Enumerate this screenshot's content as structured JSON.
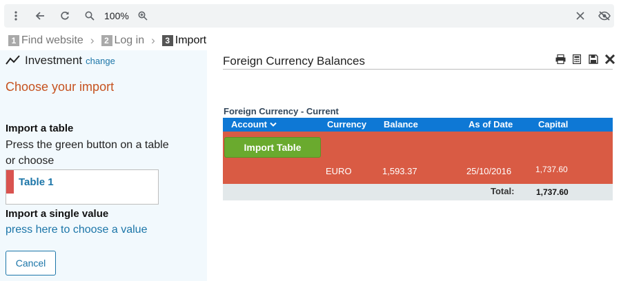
{
  "toolbar": {
    "zoom": "100%",
    "icons": [
      "more-vert-icon",
      "back-arrow-icon",
      "refresh-icon",
      "zoom-out-icon",
      "zoom-in-icon",
      "close-icon",
      "hide-icon"
    ]
  },
  "breadcrumb": [
    {
      "num": "1",
      "label": "Find website"
    },
    {
      "num": "2",
      "label": "Log in"
    },
    {
      "num": "3",
      "label": "Import"
    }
  ],
  "sidebar": {
    "investment_label": "Investment",
    "change_link": "change",
    "choose_title": "Choose your import",
    "import_table_heading": "Import a table",
    "import_table_desc_1": "Press the green button on a table",
    "import_table_desc_2": "or choose",
    "tables": [
      {
        "label": "Table 1"
      }
    ],
    "single_value_heading": "Import a single value",
    "single_value_link": "press here to choose a value",
    "cancel_label": "Cancel"
  },
  "main": {
    "title": "Foreign Currency Balances",
    "table_caption": "Foreign Currency - Current",
    "columns": [
      "Account",
      "Currency",
      "Balance",
      "As of Date",
      "Capital"
    ],
    "import_button": "Import Table",
    "row": {
      "currency": "EURO",
      "balance": "1,593.37",
      "as_of_date": "25/10/2016",
      "capital": "1,737.60"
    },
    "total_label": "Total:",
    "total_value": "1,737.60"
  },
  "colors": {
    "accent_link": "#1b75a8",
    "heading_orange": "#c6521f",
    "header_blue": "#0e78d5",
    "table_highlight_red": "#d95b44",
    "import_green": "#6aaa2e"
  }
}
